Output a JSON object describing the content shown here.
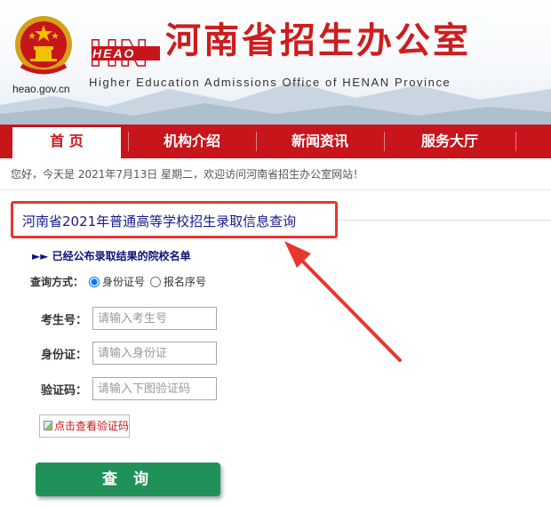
{
  "header": {
    "title": "河南省招生办公室",
    "subtitle": "Higher Education Admissions Office of HENAN Province",
    "domain": "heao.gov.cn",
    "logo_text": "HEAO"
  },
  "nav": {
    "items": [
      {
        "label": "首 页",
        "active": true
      },
      {
        "label": "机构介绍",
        "active": false
      },
      {
        "label": "新闻资讯",
        "active": false
      },
      {
        "label": "服务大厅",
        "active": false
      }
    ]
  },
  "welcome": "您好，今天是 2021年7月13日 星期二，欢迎访问河南省招生办公室网站！",
  "query": {
    "title": "河南省2021年普通高等学校招生录取信息查询",
    "list_link": "►► 已经公布录取结果的院校名单",
    "mode_label": "查询方式：",
    "mode_options": [
      "身份证号",
      "报名序号"
    ],
    "mode_selected": "身份证号",
    "fields": [
      {
        "label": "考生号：",
        "placeholder": "请输入考生号"
      },
      {
        "label": "身份证：",
        "placeholder": "请输入身份证"
      },
      {
        "label": "验证码：",
        "placeholder": "请输入下图验证码"
      }
    ],
    "captcha_alt": "点击查看验证码",
    "submit_label": "查 询"
  },
  "colors": {
    "brand_red": "#c8141b",
    "highlight_red": "#e8372f",
    "button_green": "#21915a",
    "title_blue": "#1a1a8c"
  }
}
